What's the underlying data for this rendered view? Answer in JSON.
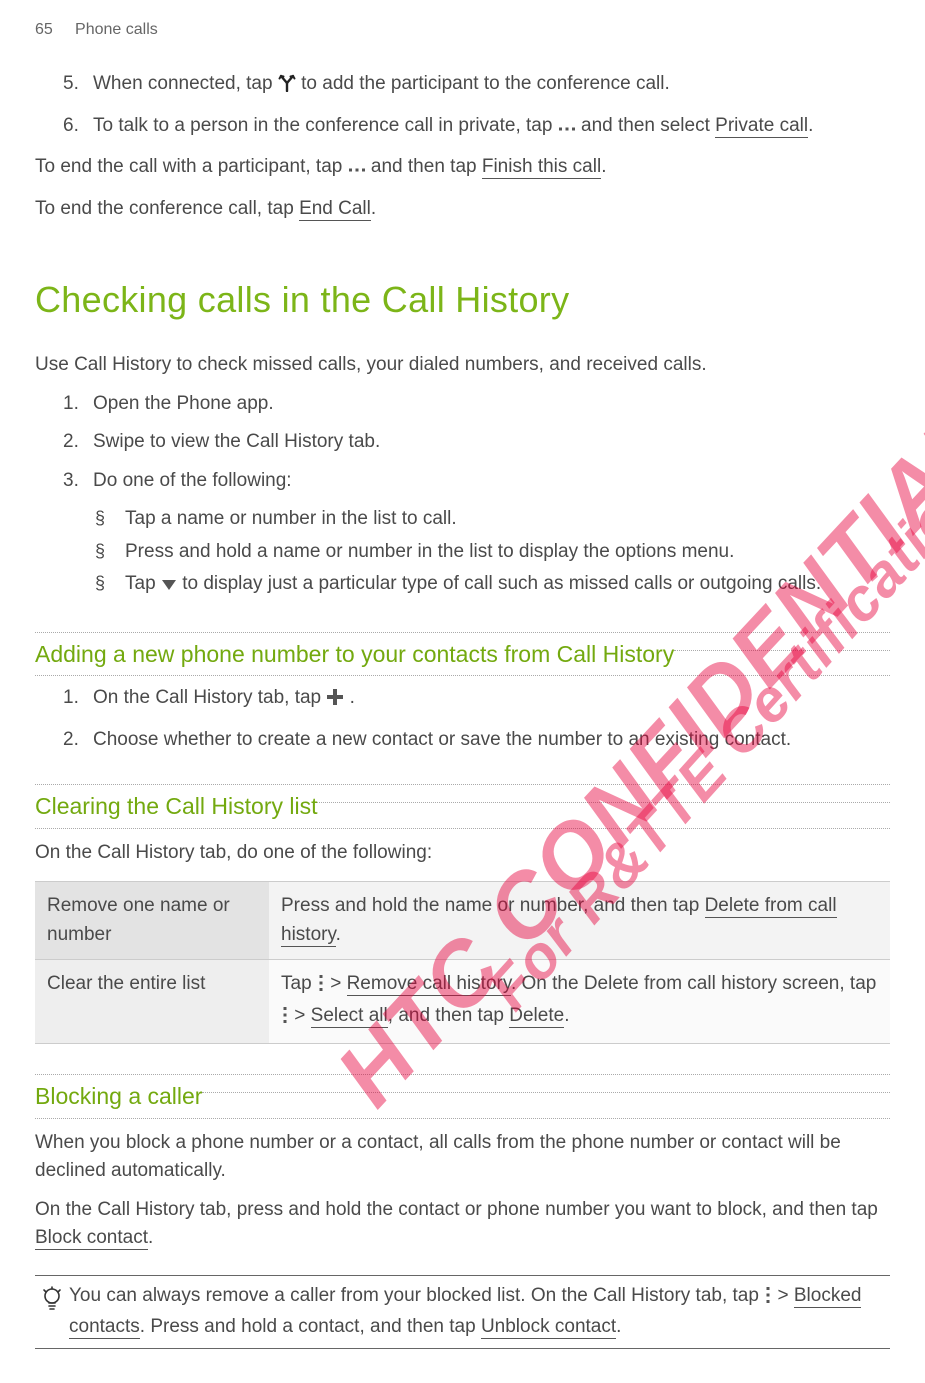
{
  "header": {
    "page_num": "65",
    "section": "Phone calls"
  },
  "steps_a": {
    "s5": {
      "num": "5.",
      "pre": "When connected, tap ",
      "post": " to add the participant to the conference call."
    },
    "s6": {
      "num": "6.",
      "pre": "To talk to a person in the conference call in private, tap ",
      "mid": " and then select ",
      "link": "Private call",
      "post": "."
    }
  },
  "end_para1": {
    "pre": "To end the call with a participant, tap ",
    "mid": " and then tap ",
    "link": "Finish this call",
    "post": "."
  },
  "end_para2": {
    "pre": "To end the conference call, tap ",
    "link": "End Call",
    "post": "."
  },
  "h1": "Checking calls in the Call History",
  "intro2": "Use Call History to check missed calls, your dialed numbers, and received calls.",
  "steps_b": {
    "s1": {
      "num": "1.",
      "text": "Open the Phone app."
    },
    "s2": {
      "num": "2.",
      "text": "Swipe to view the Call History tab."
    },
    "s3": {
      "num": "3.",
      "text": "Do one of the following:"
    }
  },
  "bullets": {
    "b1": "Tap a name or number in the list to call.",
    "b2": "Press and hold a name or number in the list to display the options menu.",
    "b3": {
      "pre": "Tap ",
      "post": " to display just a particular type of call such as missed calls or outgoing calls."
    }
  },
  "sub1": {
    "title": "Adding a new phone number to your contacts from Call History",
    "s1": {
      "num": "1.",
      "pre": "On the Call History tab, tap ",
      "post": "."
    },
    "s2": {
      "num": "2.",
      "text": "Choose whether to create a new contact or save the number to an existing contact."
    }
  },
  "sub2": {
    "title": "Clearing the Call History list",
    "intro": "On the Call History tab, do one of the following:",
    "row1": {
      "left": "Remove one name or number",
      "right_pre": "Press and hold the name or number, and then tap ",
      "right_link": "Delete from call history",
      "right_post": "."
    },
    "row2": {
      "left": "Clear the entire list",
      "r_pre": "Tap ",
      "r_gt1": " > ",
      "r_link1": "Remove call history",
      "r_mid": ". On the Delete from call history screen, tap ",
      "r_gt2": " > ",
      "r_link2": "Select all",
      "r_mid2": ", and then tap ",
      "r_link3": "Delete",
      "r_post": "."
    }
  },
  "sub3": {
    "title": "Blocking a caller",
    "p1": "When you block a phone number or a contact, all calls from the phone number or contact will be declined automatically.",
    "p2": {
      "pre": "On the Call History tab, press and hold the contact or phone number you want to block, and then tap ",
      "link": "Block contact",
      "post": "."
    }
  },
  "tip": {
    "pre": "You can always remove a caller from your blocked list. On the Call History tab, tap ",
    "gt": " > ",
    "link1": "Blocked contacts",
    "mid": ". Press and hold a contact, and then tap ",
    "link2": "Unblock contact",
    "post": "."
  },
  "watermarks": {
    "w1": "HTC CONFIDENTIAL",
    "w2": "For R&TTE Certification only"
  },
  "chart_data": null
}
